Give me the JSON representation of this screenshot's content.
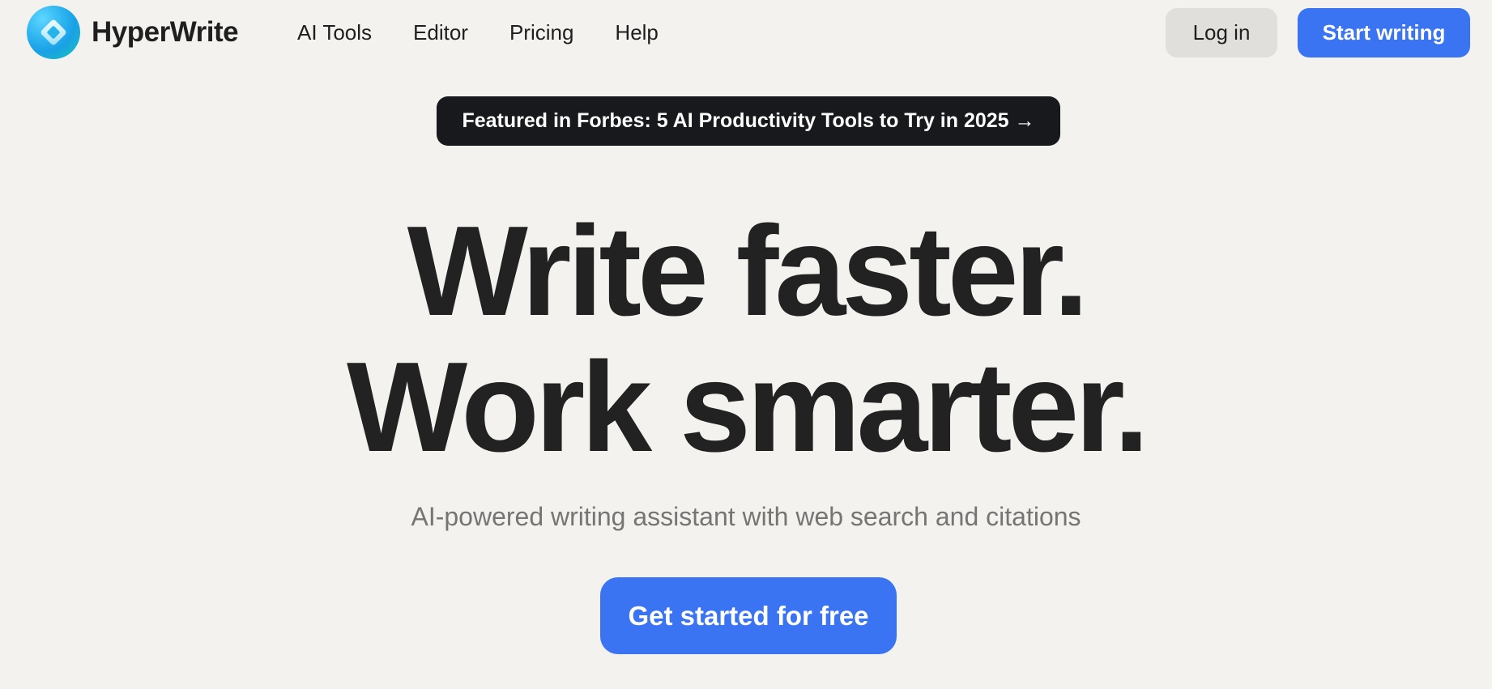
{
  "brand": {
    "name": "HyperWrite",
    "logo_icon": "hyperwrite-logo-icon",
    "logo_colors": [
      "#2fb6f0",
      "#17c9b4"
    ]
  },
  "nav": {
    "items": [
      {
        "label": "AI Tools"
      },
      {
        "label": "Editor"
      },
      {
        "label": "Pricing"
      },
      {
        "label": "Help"
      }
    ]
  },
  "header_actions": {
    "login_label": "Log in",
    "start_label": "Start writing"
  },
  "announcement": {
    "text": "Featured in Forbes: 5 AI Productivity Tools to Try in 2025 →"
  },
  "hero": {
    "line1": "Write faster.",
    "line2": "Work smarter.",
    "subtitle": "AI-powered writing assistant with web search and citations",
    "cta_label": "Get started for free"
  },
  "colors": {
    "background": "#f3f2ef",
    "accent": "#3b74f2",
    "dark_pill": "#17191c",
    "secondary_button": "#e0dfdc",
    "subtitle_text": "#777574"
  }
}
